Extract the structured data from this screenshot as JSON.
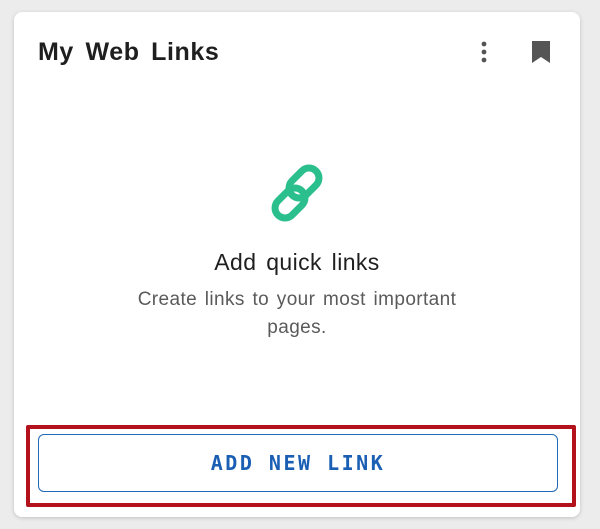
{
  "card": {
    "title": "My Web Links"
  },
  "header_actions": {
    "more_icon": "more-vertical-icon",
    "bookmark_icon": "bookmark-icon"
  },
  "empty_state": {
    "icon": "link-icon",
    "heading": "Add quick links",
    "description": "Create links to your most important pages."
  },
  "add_button": {
    "label": "ADD NEW LINK"
  },
  "colors": {
    "accent_green": "#2bbf8e",
    "button_blue": "#1a5fb4",
    "highlight_red": "#b3121c",
    "icon_gray": "#555555"
  }
}
